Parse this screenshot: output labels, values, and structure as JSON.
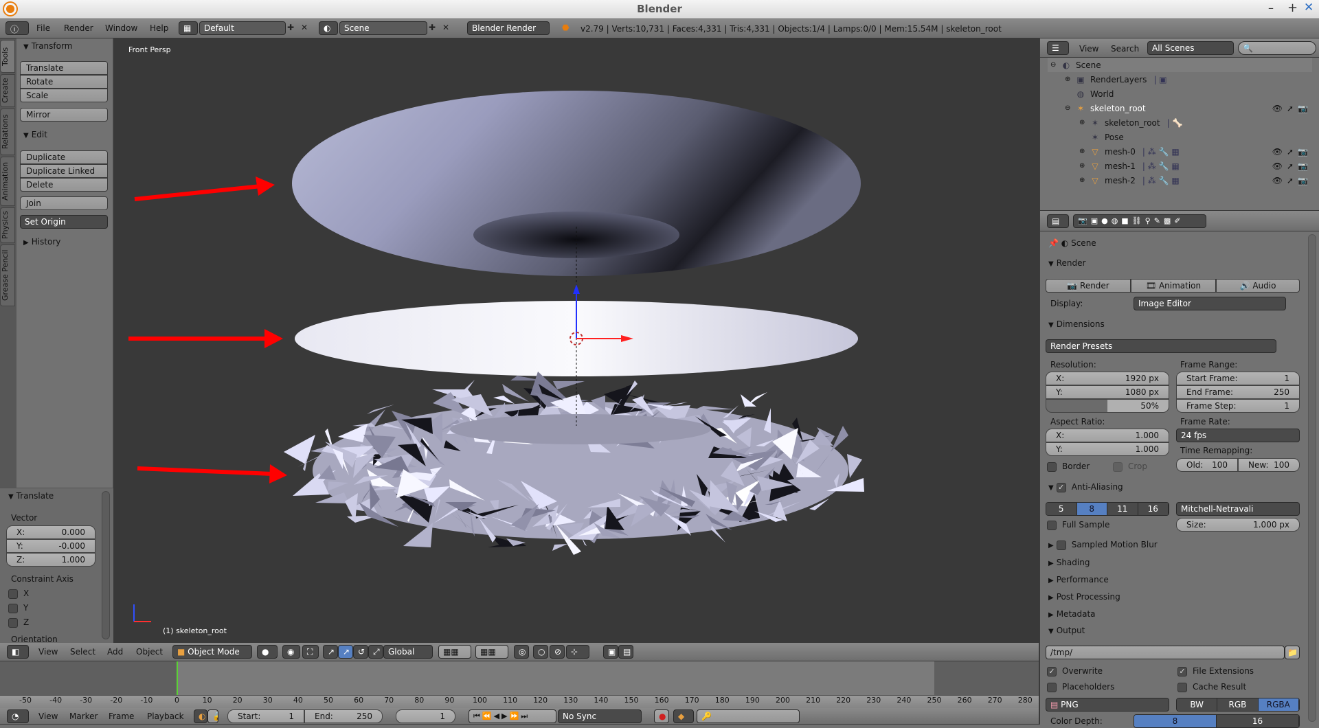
{
  "window": {
    "title": "Blender"
  },
  "info_header": {
    "menus": [
      "File",
      "Render",
      "Window",
      "Help"
    ],
    "layout": "Default",
    "scene": "Scene",
    "engine": "Blender Render",
    "stats": "v2.79 | Verts:10,731 | Faces:4,331 | Tris:4,331 | Objects:1/4 | Lamps:0/0 | Mem:15.54M | skeleton_root"
  },
  "tool_tabs": [
    "Tools",
    "Create",
    "Relations",
    "Animation",
    "Physics",
    "Grease Pencil"
  ],
  "tool_shelf": {
    "transform": {
      "title": "Transform",
      "buttons": [
        "Translate",
        "Rotate",
        "Scale",
        "Mirror"
      ]
    },
    "edit": {
      "title": "Edit",
      "buttons": [
        "Duplicate",
        "Duplicate Linked",
        "Delete",
        "Join"
      ],
      "set_origin": "Set Origin"
    },
    "history": {
      "title": "History"
    }
  },
  "operator": {
    "title": "Translate",
    "vector_label": "Vector",
    "x": {
      "label": "X:",
      "value": "0.000"
    },
    "y": {
      "label": "Y:",
      "value": "-0.000"
    },
    "z": {
      "label": "Z:",
      "value": "1.000"
    },
    "constraint_label": "Constraint Axis",
    "axes": [
      "X",
      "Y",
      "Z"
    ],
    "orientation_label": "Orientation"
  },
  "viewport": {
    "view_name": "Front Persp",
    "object_label": "(1) skeleton_root",
    "annotation_color": "#ff0000"
  },
  "view3d_header": {
    "menus": [
      "View",
      "Select",
      "Add",
      "Object"
    ],
    "mode": "Object Mode",
    "orientation": "Global"
  },
  "timeline": {
    "ticks": [
      -50,
      -40,
      -30,
      -20,
      -10,
      0,
      10,
      20,
      30,
      40,
      50,
      60,
      70,
      80,
      90,
      100,
      110,
      120,
      130,
      140,
      150,
      160,
      170,
      180,
      190,
      200,
      210,
      220,
      230,
      240,
      250,
      260,
      270,
      280
    ],
    "current_frame_marker": 0,
    "menus": [
      "View",
      "Marker",
      "Frame",
      "Playback"
    ],
    "start_label": "Start:",
    "start": "1",
    "end_label": "End:",
    "end": "250",
    "current": "1",
    "sync": "No Sync"
  },
  "outliner": {
    "menus": [
      "View",
      "Search"
    ],
    "filter": "All Scenes",
    "items": [
      {
        "label": "Scene"
      },
      {
        "label": "RenderLayers"
      },
      {
        "label": "World"
      },
      {
        "label": "skeleton_root"
      },
      {
        "label": "skeleton_root"
      },
      {
        "label": "Pose"
      },
      {
        "label": "mesh-0"
      },
      {
        "label": "mesh-1"
      },
      {
        "label": "mesh-2"
      }
    ]
  },
  "properties": {
    "breadcrumb": "Scene",
    "render": {
      "title": "Render",
      "buttons": [
        "Render",
        "Animation",
        "Audio"
      ],
      "display_label": "Display:",
      "display": "Image Editor"
    },
    "dimensions": {
      "title": "Dimensions",
      "presets": "Render Presets",
      "resolution_label": "Resolution:",
      "res_x": {
        "label": "X:",
        "value": "1920 px"
      },
      "res_y": {
        "label": "Y:",
        "value": "1080 px"
      },
      "res_pct": "50%",
      "res_pct_value": 50,
      "aspect_label": "Aspect Ratio:",
      "asp_x": {
        "label": "X:",
        "value": "1.000"
      },
      "asp_y": {
        "label": "Y:",
        "value": "1.000"
      },
      "border": "Border",
      "crop": "Crop",
      "frame_range_label": "Frame Range:",
      "start": {
        "label": "Start Frame:",
        "value": "1"
      },
      "end": {
        "label": "End Frame:",
        "value": "250"
      },
      "step": {
        "label": "Frame Step:",
        "value": "1"
      },
      "frame_rate_label": "Frame Rate:",
      "frame_rate": "24 fps",
      "remap_label": "Time Remapping:",
      "old": {
        "label": "Old:",
        "value": "100"
      },
      "new": {
        "label": "New:",
        "value": "100"
      }
    },
    "aa": {
      "title": "Anti-Aliasing",
      "enabled": true,
      "samples": [
        "5",
        "8",
        "11",
        "16"
      ],
      "selected": "8",
      "filter": "Mitchell-Netravali",
      "full_sample": "Full Sample",
      "size": {
        "label": "Size:",
        "value": "1.000 px"
      }
    },
    "collapsed": [
      "Sampled Motion Blur",
      "Shading",
      "Performance",
      "Post Processing",
      "Metadata"
    ],
    "output": {
      "title": "Output",
      "path": "/tmp/",
      "overwrite": "Overwrite",
      "file_ext": "File Extensions",
      "placeholders": "Placeholders",
      "cache": "Cache Result",
      "format": "PNG",
      "color_modes": [
        "BW",
        "RGB",
        "RGBA"
      ],
      "color_mode": "RGBA",
      "depth_label": "Color Depth:",
      "depths": [
        "8",
        "16"
      ],
      "depth": "8"
    }
  }
}
